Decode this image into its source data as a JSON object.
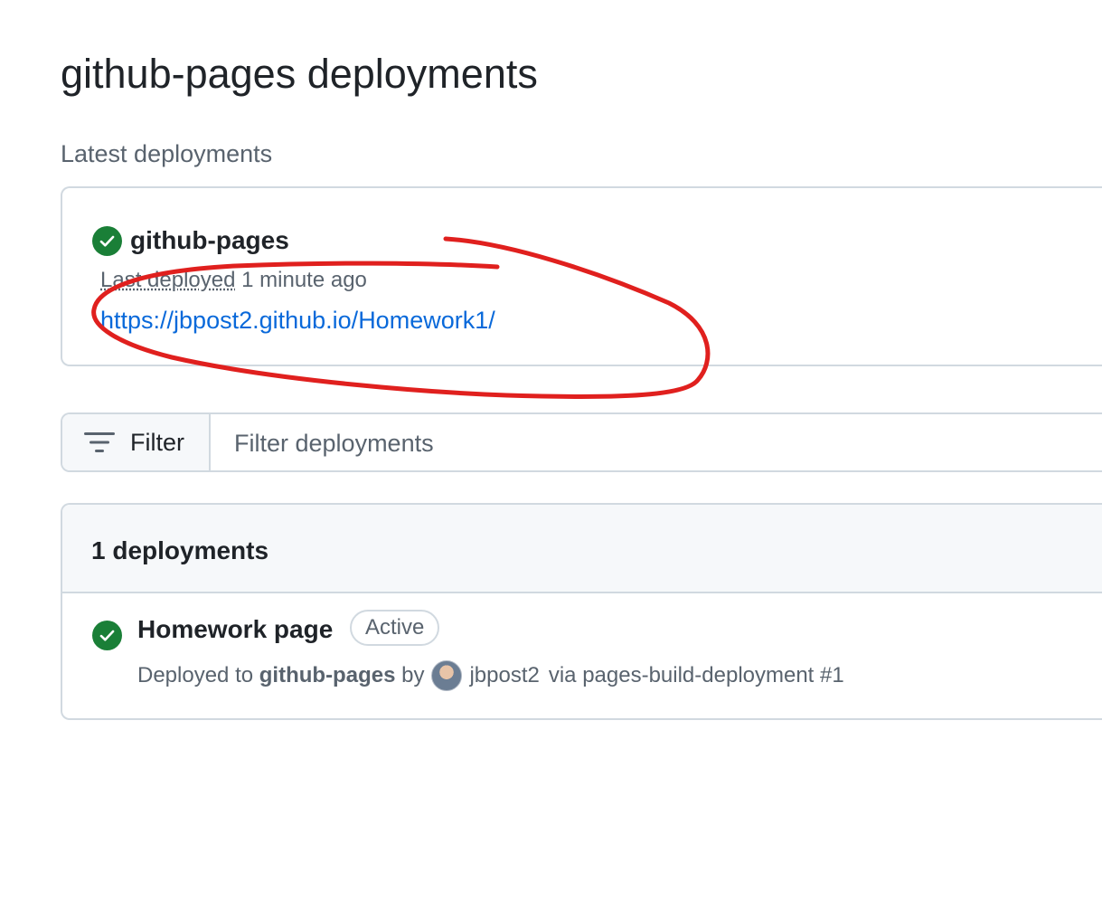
{
  "page": {
    "title": "github-pages deployments",
    "section_label": "Latest deployments"
  },
  "latest": {
    "environment": "github-pages",
    "last_deployed_label": "Last deployed",
    "last_deployed_time": "1 minute ago",
    "url": "https://jbpost2.github.io/Homework1/"
  },
  "filter": {
    "button_label": "Filter",
    "placeholder": "Filter deployments"
  },
  "list": {
    "count_label": "1 deployments",
    "items": [
      {
        "name": "Homework page",
        "status_badge": "Active",
        "deployed_to_label": "Deployed to",
        "environment": "github-pages",
        "by_label": "by",
        "user": "jbpost2",
        "via_text": "via pages-build-deployment #1"
      }
    ]
  },
  "colors": {
    "success": "#1a7f37",
    "link": "#0969da",
    "annotation": "#e0201e"
  }
}
